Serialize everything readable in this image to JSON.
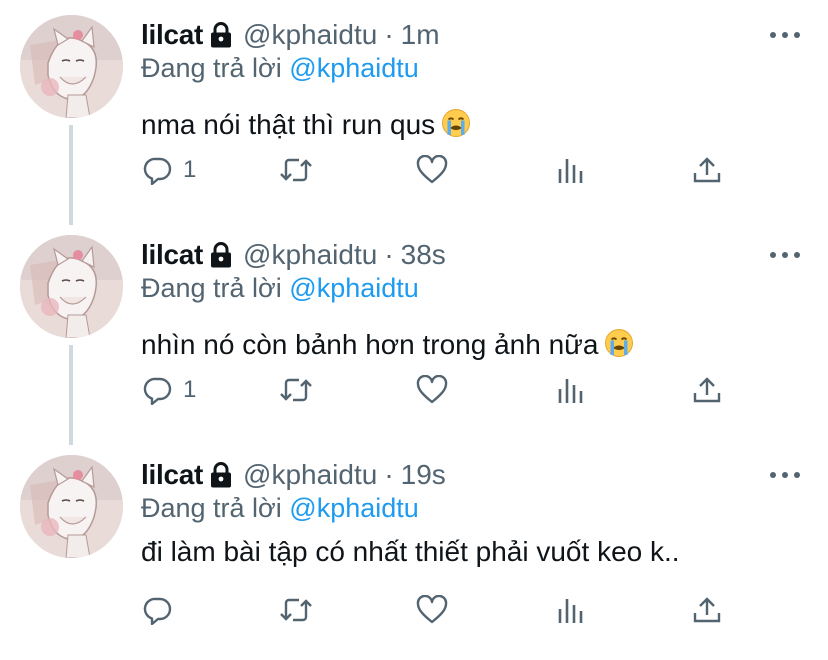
{
  "tweets": [
    {
      "name": "lilcat",
      "handle": "@kphaidtu",
      "dot": "·",
      "time": "1m",
      "reply_prefix": "Đang trả lời",
      "reply_to": "@kphaidtu",
      "text": "nma nói thật thì run qus",
      "reply_count": "1"
    },
    {
      "name": "lilcat",
      "handle": "@kphaidtu",
      "dot": "·",
      "time": "38s",
      "reply_prefix": "Đang trả lời",
      "reply_to": "@kphaidtu",
      "text": "nhìn nó còn bảnh hơn trong ảnh nữa",
      "reply_count": "1"
    },
    {
      "name": "lilcat",
      "handle": "@kphaidtu",
      "dot": "·",
      "time": "19s",
      "reply_prefix": "Đang trả lời",
      "reply_to": "@kphaidtu",
      "text": "đi làm bài tập có nhất thiết phải vuốt keo k..",
      "reply_count": ""
    }
  ],
  "icons": {
    "lock": "lock-icon",
    "more": "more-icon",
    "reply": "reply-icon",
    "retweet": "retweet-icon",
    "like": "heart-icon",
    "analytics": "analytics-icon",
    "share": "share-icon",
    "emoji": "loudly-crying-face-emoji"
  },
  "colors": {
    "text": "#0f1419",
    "secondary": "#536471",
    "link": "#1d9bf0",
    "thread_line": "#cfd9de"
  }
}
